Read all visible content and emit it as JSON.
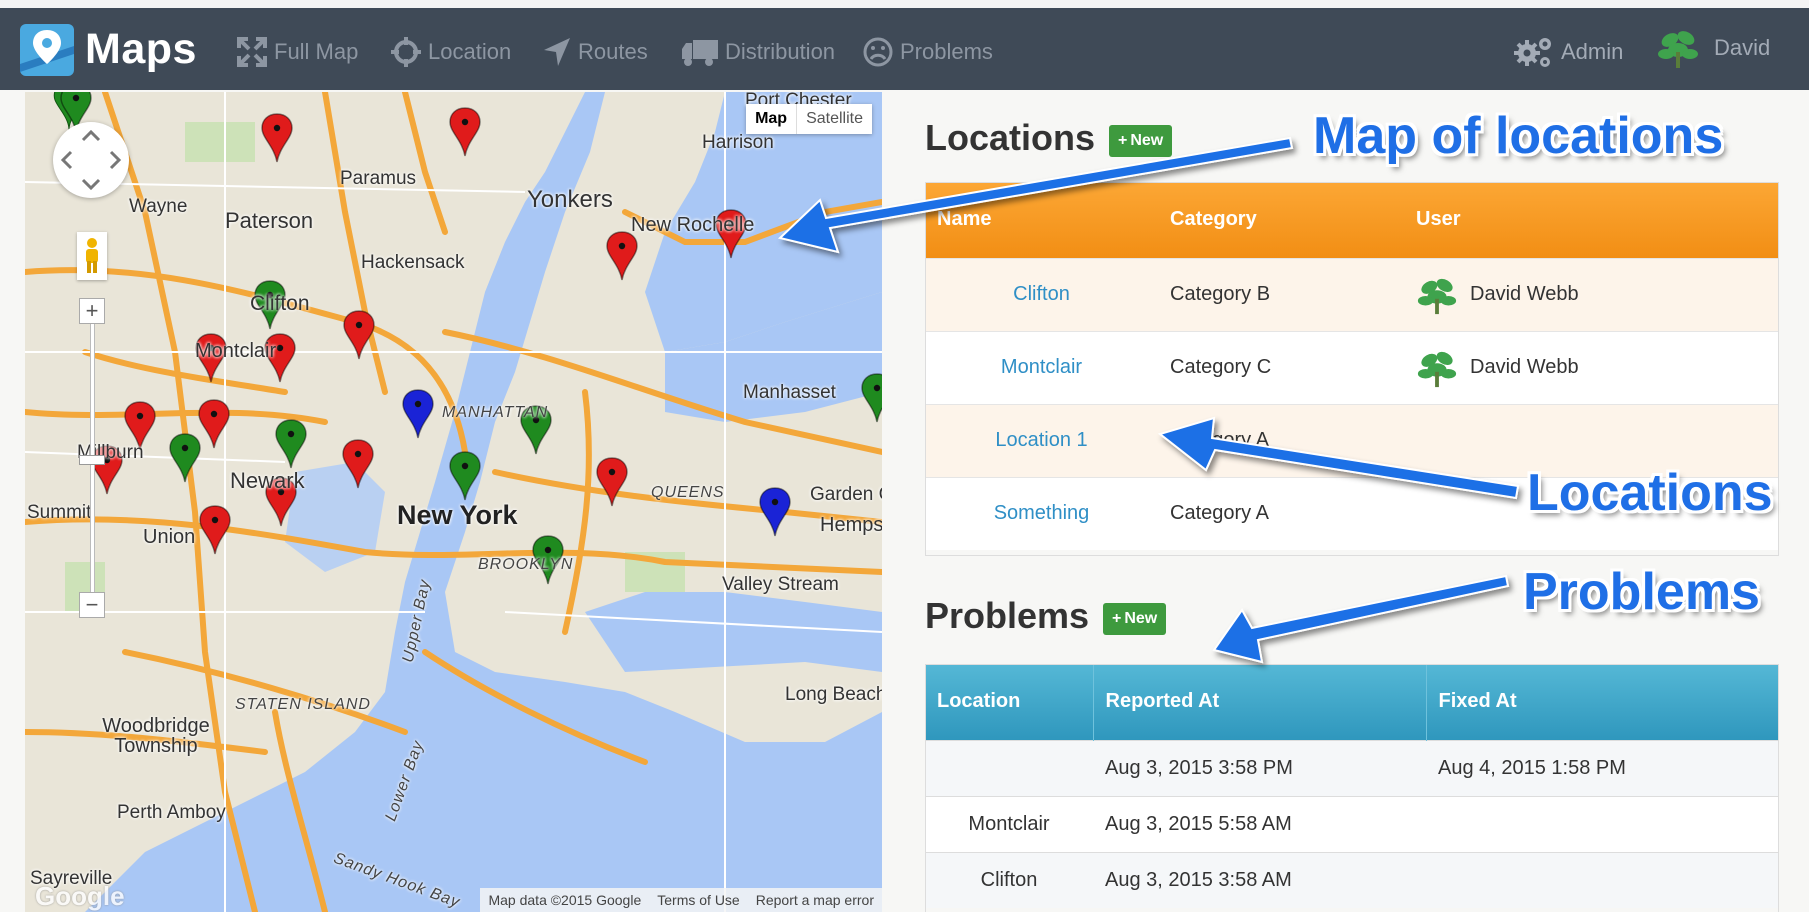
{
  "app": {
    "name": "Maps"
  },
  "nav": {
    "items": [
      {
        "label": "Full Map",
        "icon": "expand-icon"
      },
      {
        "label": "Location",
        "icon": "crosshair-icon"
      },
      {
        "label": "Routes",
        "icon": "location-arrow-icon"
      },
      {
        "label": "Distribution",
        "icon": "truck-icon"
      },
      {
        "label": "Problems",
        "icon": "frown-icon"
      }
    ],
    "admin_label": "Admin",
    "user_label": "David"
  },
  "map": {
    "type_buttons": [
      "Map",
      "Satellite"
    ],
    "labels": {
      "port_chester": "Port Chester",
      "harrison": "Harrison",
      "paramus": "Paramus",
      "yonkers": "Yonkers",
      "wayne": "Wayne",
      "paterson": "Paterson",
      "new_rochelle": "New Rochelle",
      "hackensack": "Hackensack",
      "clifton": "Clifton",
      "montclair": "Montclair",
      "manhattan": "MANHATTAN",
      "manhasset": "Manhasset",
      "millburn": "Millburn",
      "newark": "Newark",
      "new_york": "New York",
      "queens": "QUEENS",
      "garden_city": "Garden City",
      "summit": "Summit",
      "union": "Union",
      "hempstead": "Hempstead",
      "brooklyn": "BROOKLYN",
      "valley_stream": "Valley Stream",
      "upper_bay": "Upper Bay",
      "staten_island": "STATEN ISLAND",
      "long_beach": "Long Beach",
      "woodbridge": "Woodbridge Township",
      "lower_bay": "Lower Bay",
      "perth_amboy": "Perth Amboy",
      "sayreville": "Sayreville",
      "sandy_hook": "Sandy Hook Bay"
    },
    "attribution": [
      "Map data ©2015 Google",
      "Terms of Use",
      "Report a map error"
    ],
    "google_logo": "Google"
  },
  "locations": {
    "title": "Locations",
    "new_label": "New",
    "headers": [
      "Name",
      "Category",
      "User"
    ],
    "rows": [
      {
        "name": "Clifton",
        "category": "Category B",
        "user": "David Webb"
      },
      {
        "name": "Montclair",
        "category": "Category C",
        "user": "David Webb"
      },
      {
        "name": "Location 1",
        "category": "Category A",
        "user": ""
      },
      {
        "name": "Something",
        "category": "Category A",
        "user": ""
      }
    ]
  },
  "problems": {
    "title": "Problems",
    "new_label": "New",
    "headers": [
      "Location",
      "Reported At",
      "Fixed At"
    ],
    "rows": [
      {
        "location": "",
        "reported_at": "Aug 3, 2015 3:58 PM",
        "fixed_at": "Aug 4, 2015 1:58 PM"
      },
      {
        "location": "Montclair",
        "reported_at": "Aug 3, 2015 5:58 AM",
        "fixed_at": ""
      },
      {
        "location": "Clifton",
        "reported_at": "Aug 3, 2015 3:58 AM",
        "fixed_at": ""
      }
    ]
  },
  "callouts": {
    "map": "Map of locations",
    "locations": "Locations",
    "problems": "Problems"
  },
  "colors": {
    "navbar": "#3f4a57",
    "accent_orange": "#f7a028",
    "accent_blue": "#3aa6cb",
    "callout": "#1f6fe6",
    "marker_red": "#e01b1b",
    "marker_green": "#1f8a1f",
    "marker_blue": "#1a23d6"
  }
}
